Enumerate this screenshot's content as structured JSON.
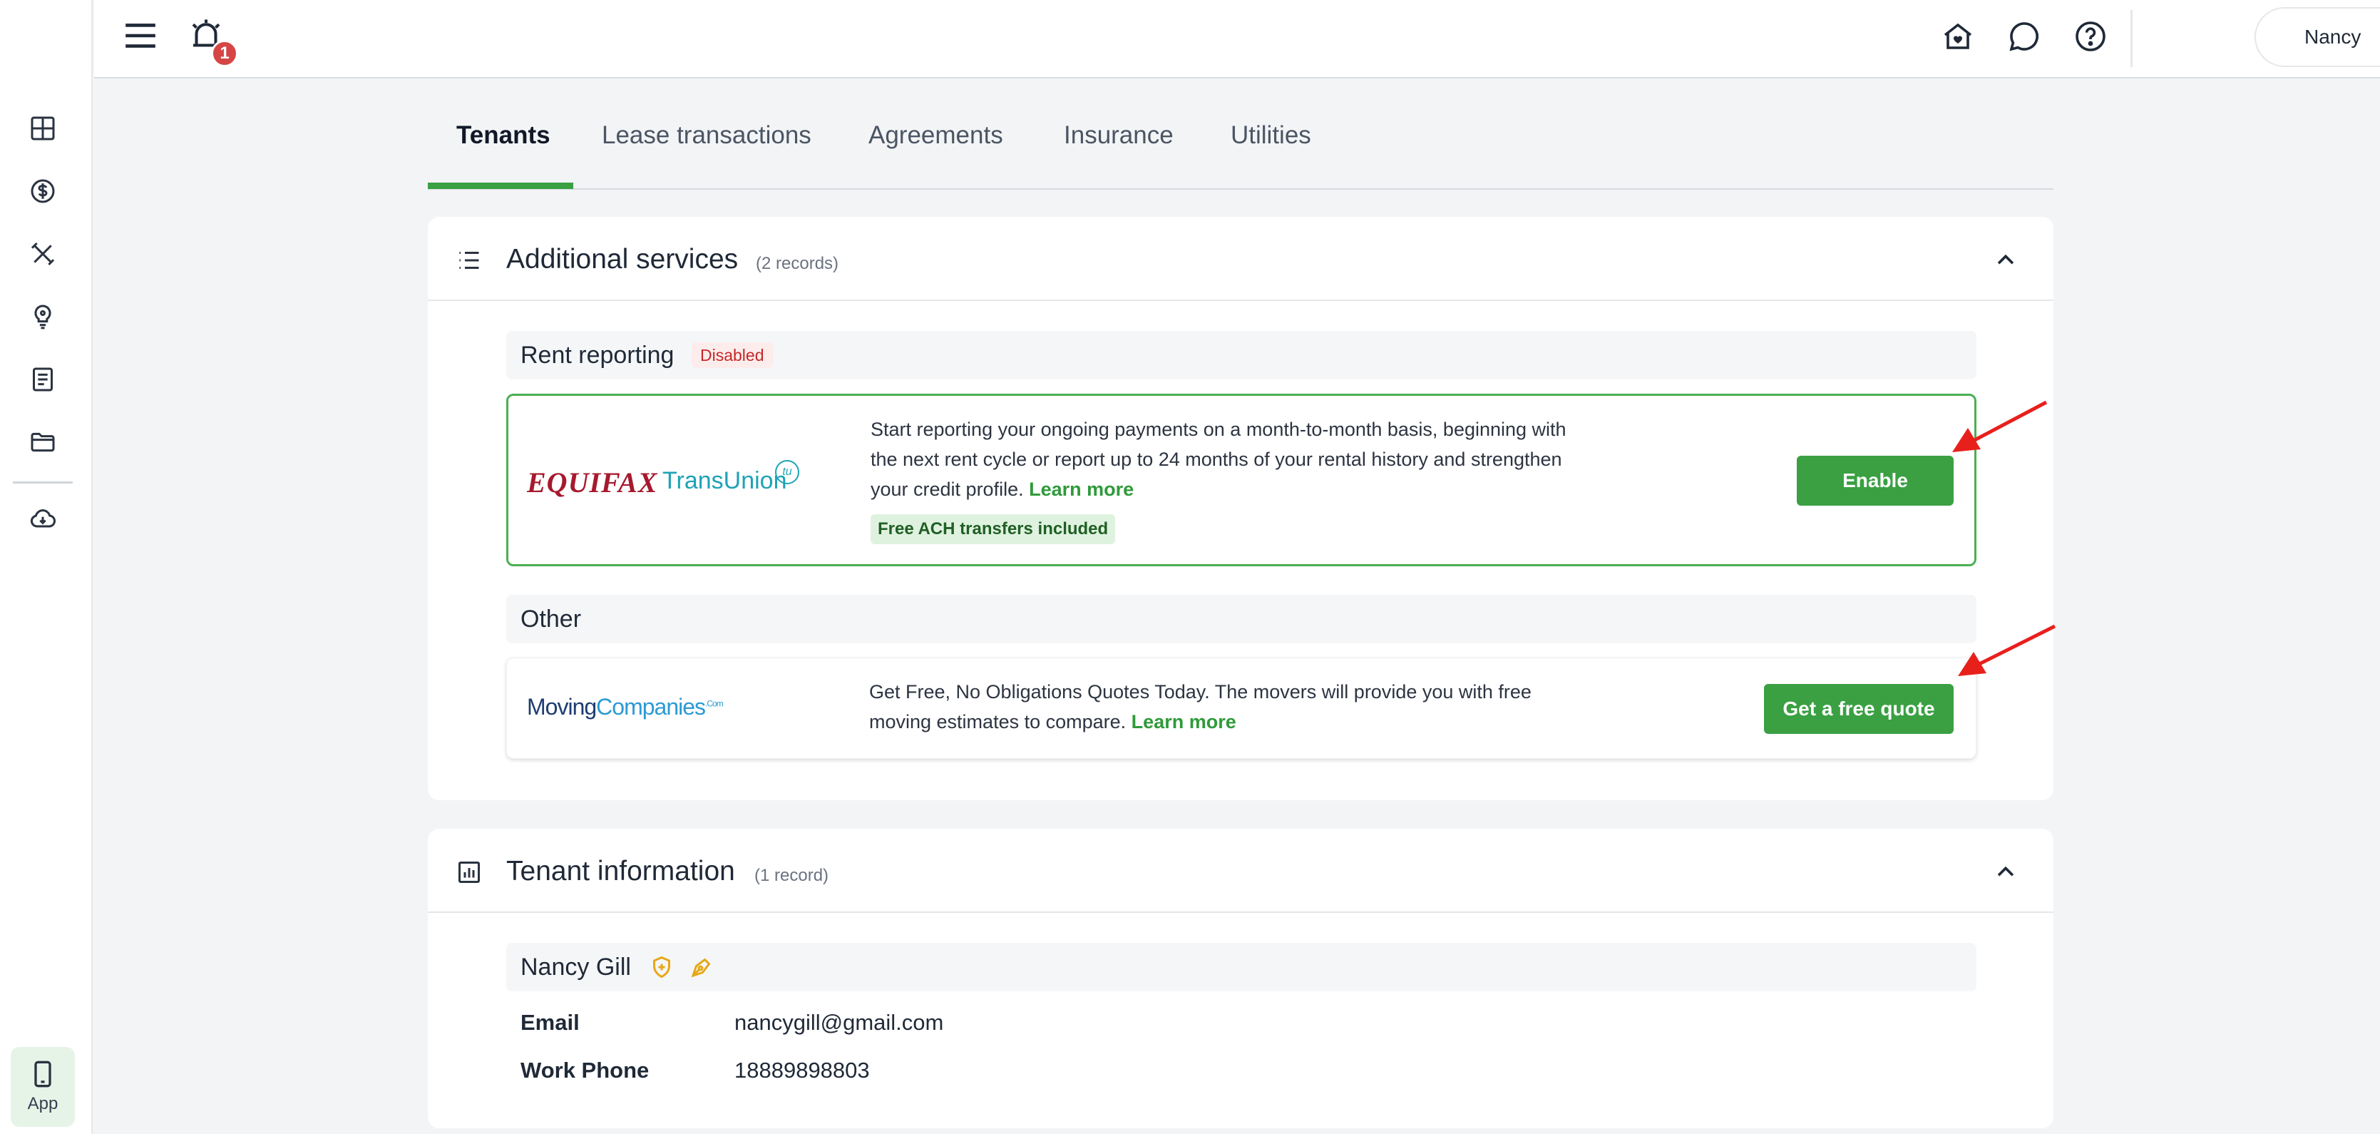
{
  "topbar": {
    "menu_icon": "hamburger-menu-icon",
    "notification_icon": "alarm-bell-icon",
    "notification_count": "1",
    "home_icon": "home-heart-icon",
    "chat_icon": "chat-bubble-icon",
    "help_icon": "help-circle-icon",
    "user_name": "Nancy"
  },
  "sidebar": {
    "items": [
      {
        "icon": "dashboard-grid-icon"
      },
      {
        "icon": "dollar-circle-icon"
      },
      {
        "icon": "tools-icon"
      },
      {
        "icon": "lightbulb-icon"
      },
      {
        "icon": "document-icon"
      },
      {
        "icon": "folder-icon"
      },
      {
        "icon": "cloud-download-icon"
      }
    ],
    "app_label": "App"
  },
  "tabs": [
    {
      "label": "Tenants",
      "active": true
    },
    {
      "label": "Lease transactions",
      "active": false
    },
    {
      "label": "Agreements",
      "active": false
    },
    {
      "label": "Insurance",
      "active": false
    },
    {
      "label": "Utilities",
      "active": false
    }
  ],
  "additional_services": {
    "title": "Additional services",
    "count": "(2 records)",
    "rent_reporting": {
      "label": "Rent reporting",
      "status": "Disabled",
      "logos": [
        "EQUIFAX",
        "TransUnion",
        "tu"
      ],
      "description": "Start reporting your ongoing payments on a month-to-month basis, beginning with the next rent cycle or report up to 24 months of your rental history and strengthen your credit profile.",
      "learn_more": "Learn more",
      "tag": "Free ACH transfers included",
      "button": "Enable"
    },
    "other": {
      "label": "Other",
      "logo": [
        "Moving",
        "Companies",
        ".Com"
      ],
      "description": "Get Free, No Obligations Quotes Today. The movers will provide you with free moving estimates to compare.",
      "learn_more": "Learn more",
      "button": "Get a free quote"
    }
  },
  "tenant_information": {
    "title": "Tenant information",
    "count": "(1 record)",
    "tenant_name": "Nancy Gill",
    "fields": [
      {
        "label": "Email",
        "value": "nancygill@gmail.com"
      },
      {
        "label": "Work Phone",
        "value": "18889898803"
      }
    ]
  },
  "colors": {
    "accent_green": "#3aa042",
    "annotation_red": "#e8201c",
    "disabled_red": "#c62828",
    "badge_red": "#d64545"
  }
}
